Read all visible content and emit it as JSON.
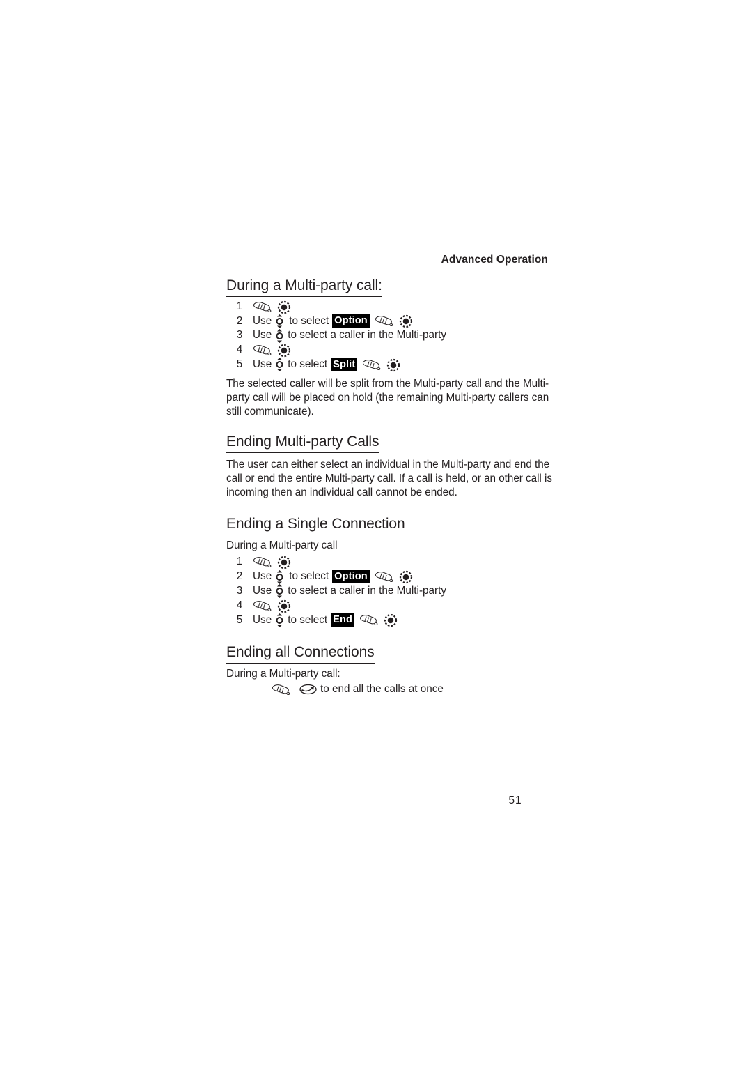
{
  "page": {
    "running_header": "Advanced Operation",
    "folio": "51"
  },
  "icons": {
    "hand": "press-key-hand-icon",
    "select": "select-key-icon",
    "nav": "up-down-navigation-key-icon",
    "end": "end-call-key-icon"
  },
  "sections": [
    {
      "heading": "During a Multi-party call:",
      "steps": [
        {
          "num": "1",
          "parts": [
            {
              "type": "icon",
              "icon": "hand"
            },
            {
              "type": "space",
              "w": 7
            },
            {
              "type": "icon",
              "icon": "select"
            }
          ]
        },
        {
          "num": "2",
          "parts": [
            {
              "type": "text",
              "text": "Use"
            },
            {
              "type": "space",
              "w": 5
            },
            {
              "type": "icon",
              "icon": "nav"
            },
            {
              "type": "space",
              "w": 7
            },
            {
              "type": "text",
              "text": "to select"
            },
            {
              "type": "space",
              "w": 5
            },
            {
              "type": "key",
              "text": "Option"
            },
            {
              "type": "space",
              "w": 7
            },
            {
              "type": "icon",
              "icon": "hand"
            },
            {
              "type": "space",
              "w": 7
            },
            {
              "type": "icon",
              "icon": "select"
            }
          ]
        },
        {
          "num": "3",
          "parts": [
            {
              "type": "text",
              "text": "Use"
            },
            {
              "type": "space",
              "w": 5
            },
            {
              "type": "icon",
              "icon": "nav"
            },
            {
              "type": "space",
              "w": 5
            },
            {
              "type": "text",
              "text": "to select a caller in the Multi-party"
            }
          ]
        },
        {
          "num": "4",
          "parts": [
            {
              "type": "icon",
              "icon": "hand"
            },
            {
              "type": "space",
              "w": 7
            },
            {
              "type": "icon",
              "icon": "select"
            }
          ]
        },
        {
          "num": "5",
          "parts": [
            {
              "type": "text",
              "text": "Use"
            },
            {
              "type": "space",
              "w": 5
            },
            {
              "type": "icon",
              "icon": "nav"
            },
            {
              "type": "space",
              "w": 5
            },
            {
              "type": "text",
              "text": "to select"
            },
            {
              "type": "space",
              "w": 5
            },
            {
              "type": "key",
              "text": "Split"
            },
            {
              "type": "space",
              "w": 7
            },
            {
              "type": "icon",
              "icon": "hand"
            },
            {
              "type": "space",
              "w": 7
            },
            {
              "type": "icon",
              "icon": "select"
            }
          ]
        }
      ],
      "paragraph": "The selected caller will be split from the Multi-party call and the Multi-party call will be placed on hold (the remaining Multi-party callers can still communicate)."
    },
    {
      "heading": "Ending Multi-party Calls",
      "paragraph": "The user can either select an individual in the Multi-party and end the call or end the entire Multi-party call. If a call is held, or an other call is incoming then an individual call cannot be ended."
    },
    {
      "heading": "Ending a Single Connection",
      "intro": "During a Multi-party call",
      "steps": [
        {
          "num": "1",
          "parts": [
            {
              "type": "icon",
              "icon": "hand"
            },
            {
              "type": "space",
              "w": 7
            },
            {
              "type": "icon",
              "icon": "select"
            }
          ]
        },
        {
          "num": "2",
          "parts": [
            {
              "type": "text",
              "text": "Use"
            },
            {
              "type": "space",
              "w": 5
            },
            {
              "type": "icon",
              "icon": "nav"
            },
            {
              "type": "space",
              "w": 7
            },
            {
              "type": "text",
              "text": "to select"
            },
            {
              "type": "space",
              "w": 5
            },
            {
              "type": "key",
              "text": "Option"
            },
            {
              "type": "space",
              "w": 7
            },
            {
              "type": "icon",
              "icon": "hand"
            },
            {
              "type": "space",
              "w": 7
            },
            {
              "type": "icon",
              "icon": "select"
            }
          ]
        },
        {
          "num": "3",
          "parts": [
            {
              "type": "text",
              "text": "Use"
            },
            {
              "type": "space",
              "w": 5
            },
            {
              "type": "icon",
              "icon": "nav"
            },
            {
              "type": "space",
              "w": 5
            },
            {
              "type": "text",
              "text": "to select a caller in the Multi-party"
            }
          ]
        },
        {
          "num": "4",
          "parts": [
            {
              "type": "icon",
              "icon": "hand"
            },
            {
              "type": "space",
              "w": 7
            },
            {
              "type": "icon",
              "icon": "select"
            }
          ]
        },
        {
          "num": "5",
          "parts": [
            {
              "type": "text",
              "text": "Use"
            },
            {
              "type": "space",
              "w": 5
            },
            {
              "type": "icon",
              "icon": "nav"
            },
            {
              "type": "space",
              "w": 5
            },
            {
              "type": "text",
              "text": "to select"
            },
            {
              "type": "space",
              "w": 5
            },
            {
              "type": "key",
              "text": "End"
            },
            {
              "type": "space",
              "w": 7
            },
            {
              "type": "icon",
              "icon": "hand"
            },
            {
              "type": "space",
              "w": 7
            },
            {
              "type": "icon",
              "icon": "select"
            }
          ]
        }
      ]
    },
    {
      "heading": "Ending all Connections",
      "intro": "During a Multi-party call:",
      "icon_line": {
        "parts": [
          {
            "type": "icon",
            "icon": "hand"
          },
          {
            "type": "space",
            "w": 12
          },
          {
            "type": "icon",
            "icon": "end"
          },
          {
            "type": "space",
            "w": 5
          },
          {
            "type": "text",
            "text": "to end all the calls at once"
          }
        ]
      }
    }
  ]
}
